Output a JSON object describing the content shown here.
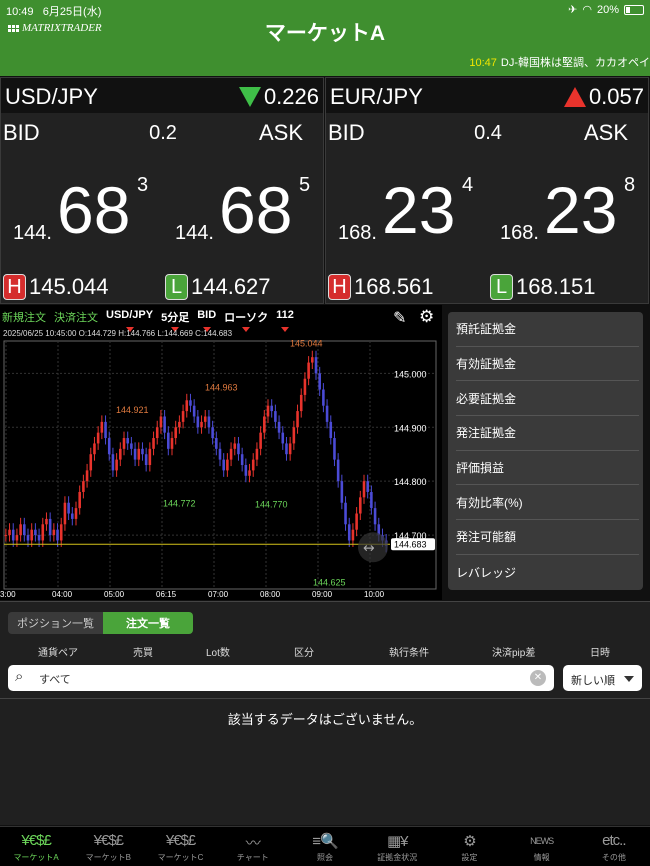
{
  "status": {
    "time": "10:49",
    "date": "6月25日(水)",
    "battery": "20%"
  },
  "header": {
    "logo": "MATRIXTRADER",
    "title": "マーケットA"
  },
  "ticker": {
    "time": "10:47",
    "text": "DJ-韓国株は堅調、カカオペイ"
  },
  "quotes": [
    {
      "pair": "USD/JPY",
      "direction": "down",
      "change": "0.226",
      "bid_label": "BID",
      "ask_label": "ASK",
      "spread": "0.2",
      "bid": {
        "prefix": "144.",
        "main": "68",
        "sup": "3"
      },
      "ask": {
        "prefix": "144.",
        "main": "68",
        "sup": "5"
      },
      "high_badge": "H",
      "high": "145.044",
      "low_badge": "L",
      "low": "144.627"
    },
    {
      "pair": "EUR/JPY",
      "direction": "up",
      "change": "0.057",
      "bid_label": "BID",
      "ask_label": "ASK",
      "spread": "0.4",
      "bid": {
        "prefix": "168.",
        "main": "23",
        "sup": "4"
      },
      "ask": {
        "prefix": "168.",
        "main": "23",
        "sup": "8"
      },
      "high_badge": "H",
      "high": "168.561",
      "low_badge": "L",
      "low": "168.151"
    }
  ],
  "chart_toolbar": {
    "new_order": "新規注文",
    "close_order": "決済注文",
    "pair": "USD/JPY",
    "interval": "5分足",
    "side": "BID",
    "style": "ローソク",
    "count": "112"
  },
  "chart_info": "2025/06/25 10:45:00   O:144.729  H:144.766  L:144.669  C:144.683",
  "chart_data": {
    "type": "candlestick",
    "x_ticks": [
      "3:00",
      "04:00",
      "05:00",
      "06:15",
      "07:00",
      "08:00",
      "09:00",
      "10:00"
    ],
    "y_ticks": [
      "145.000",
      "144.900",
      "144.800",
      "144.700"
    ],
    "ylim": [
      144.6,
      145.06
    ],
    "current_price": "144.683",
    "annotations": [
      {
        "label": "144.921",
        "value": 144.921,
        "kind": "high"
      },
      {
        "label": "144.963",
        "value": 144.963,
        "kind": "high"
      },
      {
        "label": "145.044",
        "value": 145.044,
        "kind": "high"
      },
      {
        "label": "144.772",
        "value": 144.772,
        "kind": "low"
      },
      {
        "label": "144.770",
        "value": 144.77,
        "kind": "low"
      },
      {
        "label": "144.625",
        "value": 144.625,
        "kind": "low"
      }
    ],
    "close": [
      144.7,
      144.71,
      144.69,
      144.7,
      144.72,
      144.7,
      144.69,
      144.71,
      144.7,
      144.69,
      144.72,
      144.73,
      144.7,
      144.71,
      144.69,
      144.72,
      144.76,
      144.74,
      144.73,
      144.75,
      144.78,
      144.8,
      144.82,
      144.85,
      144.87,
      144.89,
      144.91,
      144.88,
      144.85,
      144.82,
      144.84,
      144.86,
      144.88,
      144.87,
      144.86,
      144.84,
      144.86,
      144.85,
      144.83,
      144.86,
      144.88,
      144.9,
      144.92,
      144.89,
      144.86,
      144.88,
      144.9,
      144.91,
      144.93,
      144.95,
      144.94,
      144.92,
      144.9,
      144.91,
      144.92,
      144.9,
      144.88,
      144.86,
      144.84,
      144.82,
      144.84,
      144.86,
      144.87,
      144.85,
      144.83,
      144.81,
      144.82,
      144.84,
      144.86,
      144.89,
      144.92,
      144.94,
      144.93,
      144.91,
      144.89,
      144.87,
      144.85,
      144.87,
      144.9,
      144.93,
      144.96,
      144.99,
      145.02,
      145.03,
      145.0,
      144.97,
      144.94,
      144.91,
      144.88,
      144.84,
      144.8,
      144.76,
      144.72,
      144.69,
      144.71,
      144.74,
      144.77,
      144.8,
      144.78,
      144.75,
      144.72,
      144.7,
      144.69,
      144.68
    ]
  },
  "margin_panel": [
    "預託証拠金",
    "有効証拠金",
    "必要証拠金",
    "発注証拠金",
    "評価損益",
    "有効比率(%)",
    "発注可能額",
    "レバレッジ"
  ],
  "orders": {
    "tab_positions": "ポジション一覧",
    "tab_orders": "注文一覧",
    "columns": [
      "通貨ペア",
      "売買",
      "Lot数",
      "区分",
      "執行条件",
      "決済pip差",
      "日時"
    ],
    "search_placeholder": "すべて",
    "sort": "新しい順",
    "empty": "該当するデータはございません。"
  },
  "tabs": [
    {
      "icon": "¥€$£",
      "label": "マーケットA",
      "active": true
    },
    {
      "icon": "¥€$£",
      "label": "マーケットB"
    },
    {
      "icon": "¥€$£",
      "label": "マーケットC"
    },
    {
      "icon": "〰",
      "label": "チャート"
    },
    {
      "icon": "≡🔍",
      "label": "照会"
    },
    {
      "icon": "▦¥",
      "label": "証拠金状況"
    },
    {
      "icon": "⚙",
      "label": "設定"
    },
    {
      "icon": "NEWS",
      "label": "情報"
    },
    {
      "icon": "etc..",
      "label": "その他"
    }
  ],
  "colors": {
    "header": "#3f8f2f",
    "up": "#e8332c",
    "down": "#3fbf48",
    "accent": "#4aa43a"
  }
}
